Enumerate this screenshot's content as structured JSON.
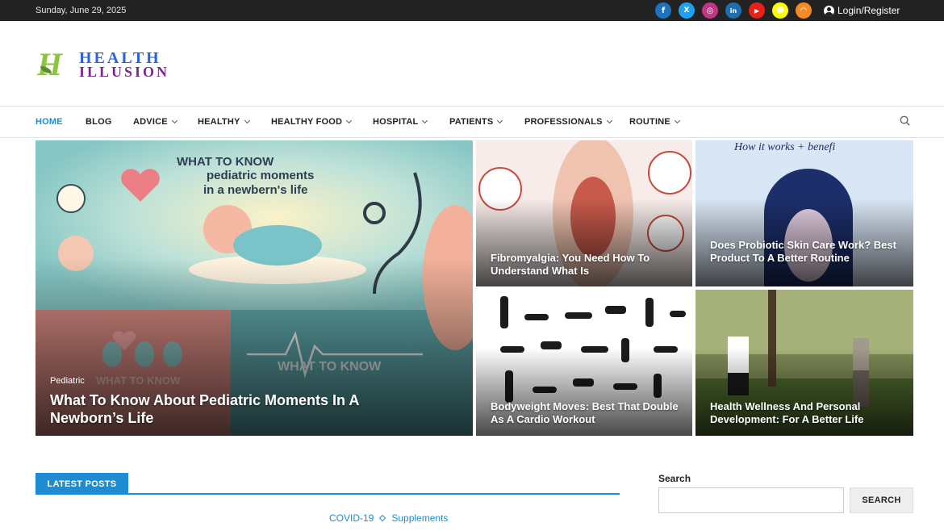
{
  "topbar": {
    "date": "Sunday, June 29, 2025",
    "social": [
      {
        "icon": "facebook-icon",
        "glyph": "f",
        "color": "#1e73be"
      },
      {
        "icon": "x-twitter-icon",
        "glyph": "𝕏",
        "color": "#1da1f2"
      },
      {
        "icon": "instagram-icon",
        "glyph": "◎",
        "color": "#c13584"
      },
      {
        "icon": "linkedin-icon",
        "glyph": "in",
        "color": "#1f6fb0"
      },
      {
        "icon": "youtube-icon",
        "glyph": "▶",
        "color": "#e62117"
      },
      {
        "icon": "snapchat-icon",
        "glyph": "☻",
        "color": "#fffc00"
      },
      {
        "icon": "rss-icon",
        "glyph": "◠",
        "color": "#f48a24"
      }
    ],
    "login": "Login/Register"
  },
  "logo": {
    "mark": "H",
    "line1": "HEALTH",
    "line2": "ILLUSION"
  },
  "nav": {
    "items": [
      {
        "label": "HOME",
        "active": true,
        "dropdown": false
      },
      {
        "label": "BLOG",
        "active": false,
        "dropdown": false
      },
      {
        "label": "ADVICE",
        "active": false,
        "dropdown": true
      },
      {
        "label": "HEALTHY",
        "active": false,
        "dropdown": true
      },
      {
        "label": "HEALTHY FOOD",
        "active": false,
        "dropdown": true
      },
      {
        "label": "HOSPITAL",
        "active": false,
        "dropdown": true
      },
      {
        "label": "PATIENTS",
        "active": false,
        "dropdown": true
      },
      {
        "label": "PROFESSIONALS",
        "active": false,
        "dropdown": true
      },
      {
        "label": "ROUTINE",
        "active": false,
        "dropdown": true
      }
    ]
  },
  "featured": {
    "main": {
      "category": "Pediatric",
      "title": "What To Know About Pediatric Moments In A Newborn’s Life",
      "image_heading": "WHAT TO KNOW pediatric moments in a newborn's life",
      "image_sub": "WHAT TO KNOW",
      "image_sub2": "WHAT TO KNOW"
    },
    "cards": [
      {
        "title": "Fibromyalgia: You Need How To Understand What Is"
      },
      {
        "title": "Does Probiotic Skin Care Work? Best Product To A Better Routine",
        "image_heading": "How it works + benefi"
      },
      {
        "title": "Bodyweight Moves: Best That Double As A Cardio Workout"
      },
      {
        "title": "Health Wellness And Personal Development: For A Better Life"
      }
    ]
  },
  "latest": {
    "tab": "LATEST POSTS",
    "categories": [
      "COVID-19",
      "Supplements"
    ]
  },
  "sidebar": {
    "search_label": "Search",
    "search_button": "SEARCH",
    "search_value": ""
  },
  "colors": {
    "accent": "#1e8cd2",
    "topbar": "#222222"
  }
}
